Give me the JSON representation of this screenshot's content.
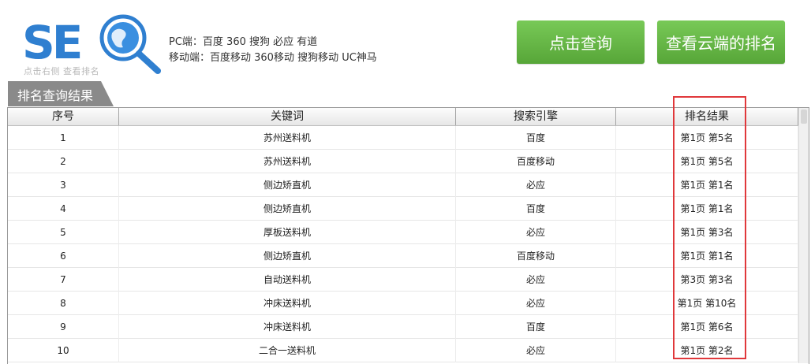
{
  "header": {
    "logo_text": "SEO",
    "logo_subtitle": "点击右侧 查看排名",
    "pc_engines": "PC端：百度 360 搜狗 必应 有道",
    "mobile_engines": "移动端：百度移动 360移动 搜狗移动 UC神马",
    "query_button": "点击查询",
    "cloud_button": "查看云端的排名"
  },
  "section": {
    "tab_label": "排名查询结果"
  },
  "table": {
    "columns": [
      "序号",
      "关键词",
      "搜索引擎",
      "排名结果"
    ],
    "rows": [
      [
        "1",
        "苏州送料机",
        "百度",
        "第1页 第5名"
      ],
      [
        "2",
        "苏州送料机",
        "百度移动",
        "第1页 第5名"
      ],
      [
        "3",
        "侧边矫直机",
        "必应",
        "第1页 第1名"
      ],
      [
        "4",
        "侧边矫直机",
        "百度",
        "第1页 第1名"
      ],
      [
        "5",
        "厚板送料机",
        "必应",
        "第1页 第3名"
      ],
      [
        "6",
        "侧边矫直机",
        "百度移动",
        "第1页 第1名"
      ],
      [
        "7",
        "自动送料机",
        "必应",
        "第3页 第3名"
      ],
      [
        "8",
        "冲床送料机",
        "必应",
        "第1页 第10名"
      ],
      [
        "9",
        "冲床送料机",
        "百度",
        "第1页 第6名"
      ],
      [
        "10",
        "二合一送料机",
        "必应",
        "第1页 第2名"
      ]
    ]
  },
  "colors": {
    "button_green": "#5aa93a",
    "logo_blue": "#2f7fd0",
    "highlight_red": "#e0383b"
  }
}
